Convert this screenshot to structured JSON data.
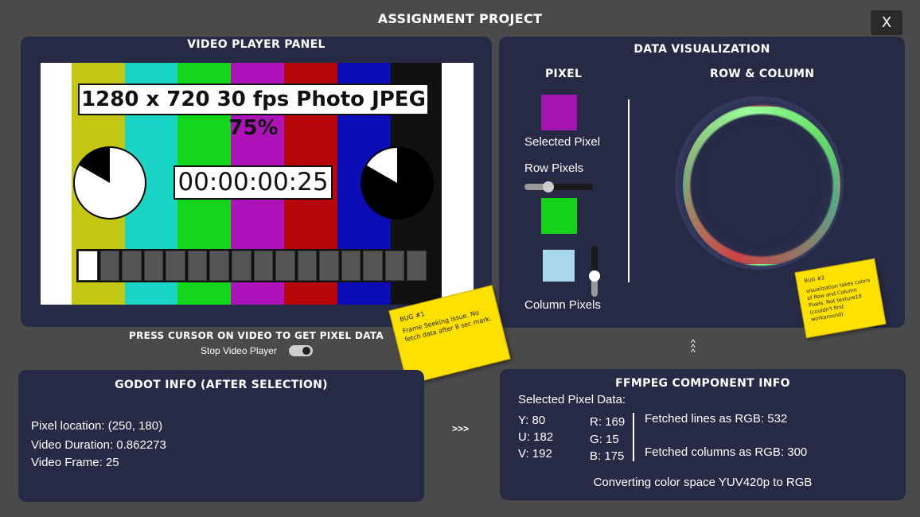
{
  "app": {
    "title": "ASSIGNMENT PROJECT",
    "close_label": "X"
  },
  "video_panel": {
    "title": "VIDEO PLAYER PANEL",
    "test_pattern": {
      "resolution_text": "1280 x 720 30 fps Photo JPEG 75%",
      "timecode": "00:00:00:25",
      "bar_colors": [
        "#ffffff",
        "#c3c713",
        "#1ad4c5",
        "#13d61a",
        "#ad13b8",
        "#b8070a",
        "#0d0db8",
        "#111111",
        "#ffffff"
      ]
    },
    "press_label": "PRESS CURSOR ON VIDEO TO GET PIXEL DATA",
    "stop_label": "Stop Video Player",
    "stop_toggle_on": true
  },
  "viz_panel": {
    "title": "DATA VISUALIZATION",
    "pixel_heading": "PIXEL",
    "row_col_heading": "ROW & COLUMN",
    "selected_pixel_label": "Selected Pixel",
    "row_pixels_label": "Row Pixels",
    "column_pixels_label": "Column Pixels",
    "colors": {
      "selected": "#a514af",
      "row": "#16d319",
      "column": "#a8d8ec"
    },
    "row_slider_value": 0.35,
    "column_slider_value": 0.4
  },
  "notes": {
    "bug1": {
      "title": "BUG #1",
      "body": "Frame Seeking issue. No fetch data after 8 sec mark."
    },
    "bug2": {
      "title": "BUG #2",
      "body": "visualization takes colors of Row and Column Pixels. Not texture10 (couldn't find workaround)"
    }
  },
  "nav": {
    "up_arrows": "^\n^\n^",
    "forward_arrows": ">>>"
  },
  "godot_panel": {
    "title": "GODOT INFO (AFTER SELECTION)",
    "pixel_location": "Pixel location: (250, 180)",
    "video_duration": "Video Duration: 0.862273",
    "video_frame": "Video Frame: 25"
  },
  "ffmpeg_panel": {
    "title": "FFMPEG COMPONENT INFO",
    "selected_label": "Selected Pixel Data:",
    "y": "Y: 80",
    "u": "U: 182",
    "v": "V: 192",
    "r": "R: 169",
    "g": "G: 15",
    "b": "B: 175",
    "lines_text": "Fetched lines as RGB: 532",
    "columns_text": "Fetched columns as RGB: 300",
    "converting": "Converting color space YUV420p to RGB"
  }
}
